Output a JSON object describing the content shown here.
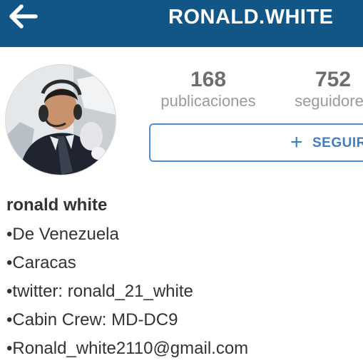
{
  "header": {
    "username": "RONALD.WHITE",
    "back_icon": "arrow-left-icon",
    "background_color": "#125688"
  },
  "profile": {
    "avatar_icon": "profile-photo",
    "stats": {
      "posts_count": "168",
      "posts_label": "publicaciones",
      "followers_count": "752",
      "followers_label": "seguidores"
    },
    "follow_button": {
      "icon": "plus-icon",
      "label": "SEGUIR",
      "accent_color": "#3f7fbf"
    },
    "full_name": "ronald white",
    "bio_lines": [
      "•De Venezuela",
      "•Caracas",
      "•twitter: ronald_21_white",
      "•Cabin Crew: MD-DC9",
      "•Ronald_white2110@gmail.com"
    ]
  }
}
